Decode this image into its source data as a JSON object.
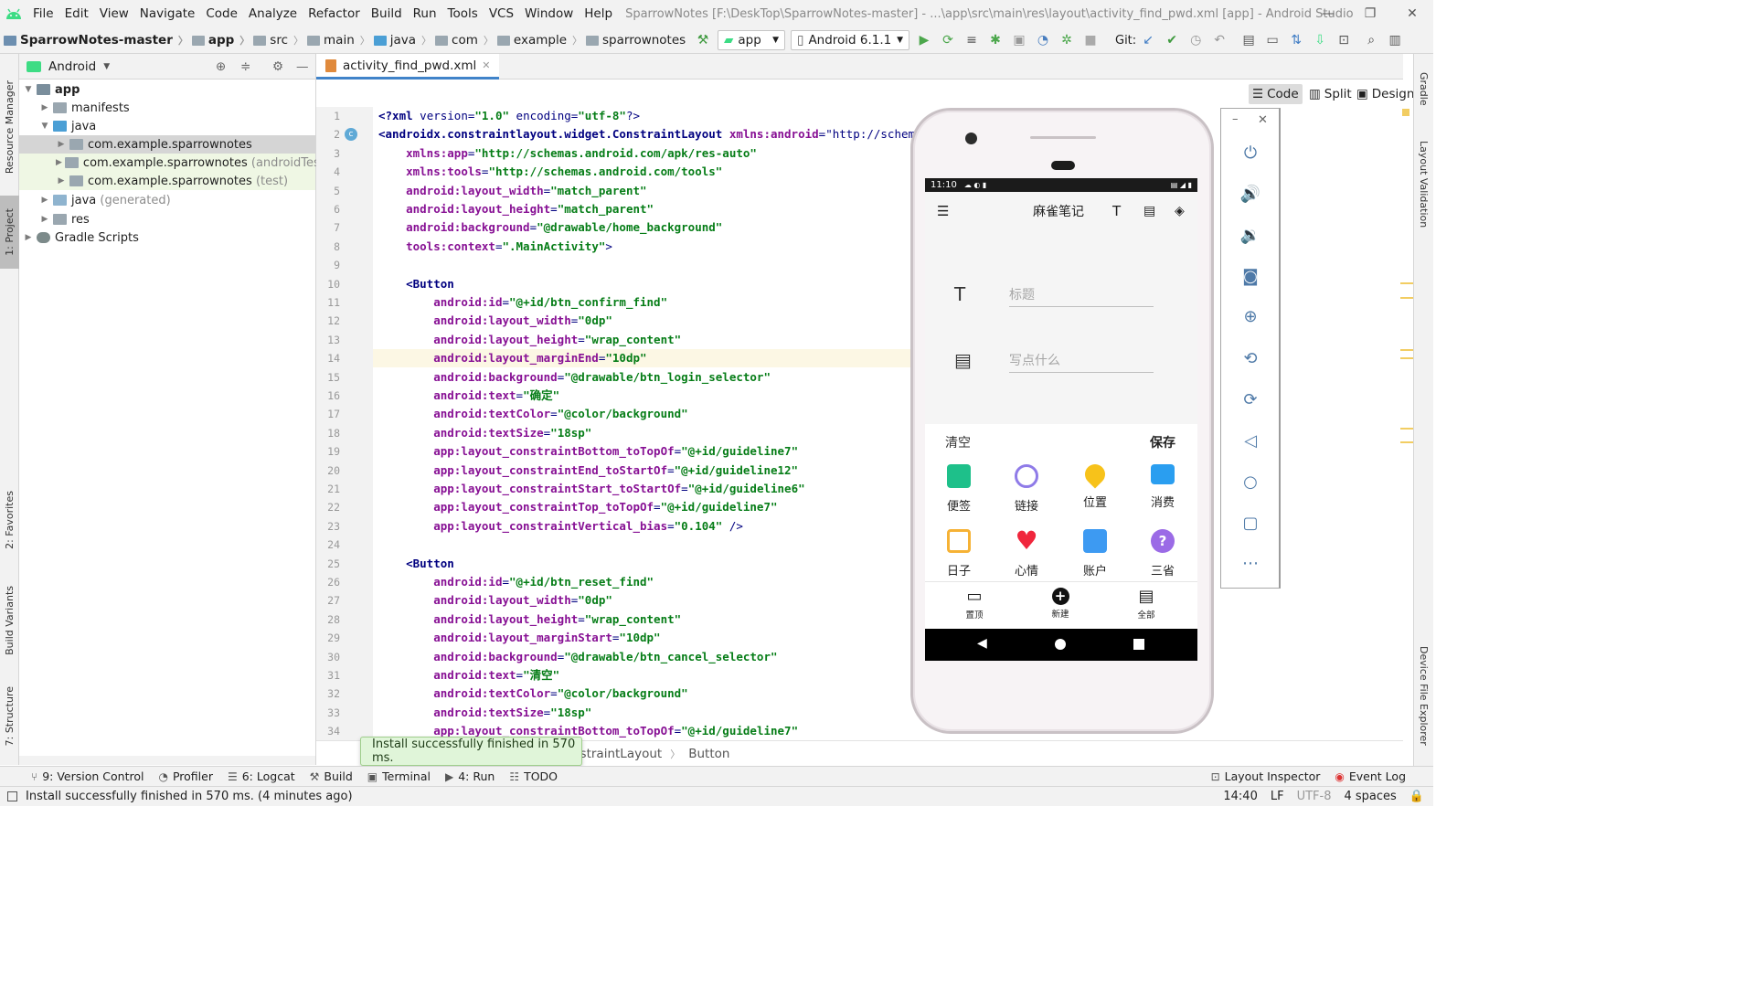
{
  "menubar": {
    "items": [
      "File",
      "Edit",
      "View",
      "Navigate",
      "Code",
      "Analyze",
      "Refactor",
      "Build",
      "Run",
      "Tools",
      "VCS",
      "Window",
      "Help"
    ],
    "title": "SparrowNotes [F:\\DeskTop\\SparrowNotes-master] - ...\\app\\src\\main\\res\\layout\\activity_find_pwd.xml [app] - Android Studio"
  },
  "navbar": {
    "crumbs": [
      "SparrowNotes-master",
      "app",
      "src",
      "main",
      "java",
      "com",
      "example",
      "sparrownotes"
    ],
    "run_config": "app",
    "device": "Android 6.1.1",
    "git_label": "Git:"
  },
  "side_tabs": {
    "left": [
      "Resource Manager",
      "1: Project",
      "2: Favorites",
      "Build Variants",
      "7: Structure"
    ],
    "right": [
      "Gradle",
      "Layout Validation",
      "Device File Explorer"
    ]
  },
  "project": {
    "view_label": "Android",
    "tree": [
      {
        "label": "app",
        "suffix": ""
      },
      {
        "label": "manifests",
        "suffix": ""
      },
      {
        "label": "java",
        "suffix": ""
      },
      {
        "label": "com.example.sparrownotes",
        "suffix": ""
      },
      {
        "label": "com.example.sparrownotes",
        "suffix": "(androidTest)"
      },
      {
        "label": "com.example.sparrownotes",
        "suffix": "(test)"
      },
      {
        "label": "java",
        "suffix": "(generated)"
      },
      {
        "label": "res",
        "suffix": ""
      },
      {
        "label": "Gradle Scripts",
        "suffix": ""
      }
    ]
  },
  "editor": {
    "tab": "activity_find_pwd.xml",
    "view_modes": [
      "Code",
      "Split",
      "Design"
    ],
    "line_numbers": [
      "1",
      "2",
      "3",
      "4",
      "5",
      "6",
      "7",
      "8",
      "9",
      "10",
      "11",
      "12",
      "13",
      "14",
      "15",
      "16",
      "17",
      "18",
      "19",
      "20",
      "21",
      "22",
      "23",
      "24",
      "25",
      "26",
      "27",
      "28",
      "29",
      "30",
      "31",
      "32",
      "33",
      "34"
    ],
    "lines": [
      "<?xml version=\"1.0\" encoding=\"utf-8\"?>",
      "<androidx.constraintlayout.widget.ConstraintLayout xmlns:android=\"http://schemas",
      "    xmlns:app=\"http://schemas.android.com/apk/res-auto\"",
      "    xmlns:tools=\"http://schemas.android.com/tools\"",
      "    android:layout_width=\"match_parent\"",
      "    android:layout_height=\"match_parent\"",
      "    android:background=\"@drawable/home_background\"",
      "    tools:context=\".MainActivity\">",
      "",
      "    <Button",
      "        android:id=\"@+id/btn_confirm_find\"",
      "        android:layout_width=\"0dp\"",
      "        android:layout_height=\"wrap_content\"",
      "        android:layout_marginEnd=\"10dp\"",
      "        android:background=\"@drawable/btn_login_selector\"",
      "        android:text=\"确定\"",
      "        android:textColor=\"@color/background\"",
      "        android:textSize=\"18sp\"",
      "        app:layout_constraintBottom_toTopOf=\"@+id/guideline7\"",
      "        app:layout_constraintEnd_toStartOf=\"@+id/guideline12\"",
      "        app:layout_constraintStart_toStartOf=\"@+id/guideline6\"",
      "        app:layout_constraintTop_toTopOf=\"@+id/guideline7\"",
      "        app:layout_constraintVertical_bias=\"0.104\" />",
      "",
      "    <Button",
      "        android:id=\"@+id/btn_reset_find\"",
      "        android:layout_width=\"0dp\"",
      "        android:layout_height=\"wrap_content\"",
      "        android:layout_marginStart=\"10dp\"",
      "        android:background=\"@drawable/btn_cancel_selector\"",
      "        android:text=\"清空\"",
      "        android:textColor=\"@color/background\"",
      "        android:textSize=\"18sp\"",
      "        app:layout_constraintBottom_toTopOf=\"@+id/guideline7\""
    ],
    "breadcrumb": [
      "nstraintLayout",
      "Button"
    ]
  },
  "toast": "Install successfully finished in 570 ms.",
  "toolwindows": [
    "9: Version Control",
    "Profiler",
    "6: Logcat",
    "Build",
    "Terminal",
    "4: Run",
    "TODO"
  ],
  "toolwindows_right": [
    "Layout Inspector",
    "Event Log"
  ],
  "status": {
    "message": "Install successfully finished in 570 ms. (4 minutes ago)",
    "position": "14:40",
    "line_sep": "LF",
    "encoding": "UTF-8",
    "indent": "4 spaces"
  },
  "phone": {
    "time": "11:10",
    "app_title": "麻雀笔记",
    "title_placeholder": "标题",
    "content_placeholder": "写点什么",
    "clear": "清空",
    "save": "保存",
    "grid": [
      {
        "label": "便签",
        "color": "#1ec08a"
      },
      {
        "label": "链接",
        "color": "#8f7be8"
      },
      {
        "label": "位置",
        "color": "#f7c21a"
      },
      {
        "label": "消费",
        "color": "#2a9ef0"
      },
      {
        "label": "日子",
        "color": "#f6b235"
      },
      {
        "label": "心情",
        "color": "#f0263c"
      },
      {
        "label": "账户",
        "color": "#3d9af2"
      },
      {
        "label": "三省",
        "color": "#9b6be6"
      }
    ],
    "bottom": [
      "置顶",
      "新建",
      "全部"
    ]
  }
}
